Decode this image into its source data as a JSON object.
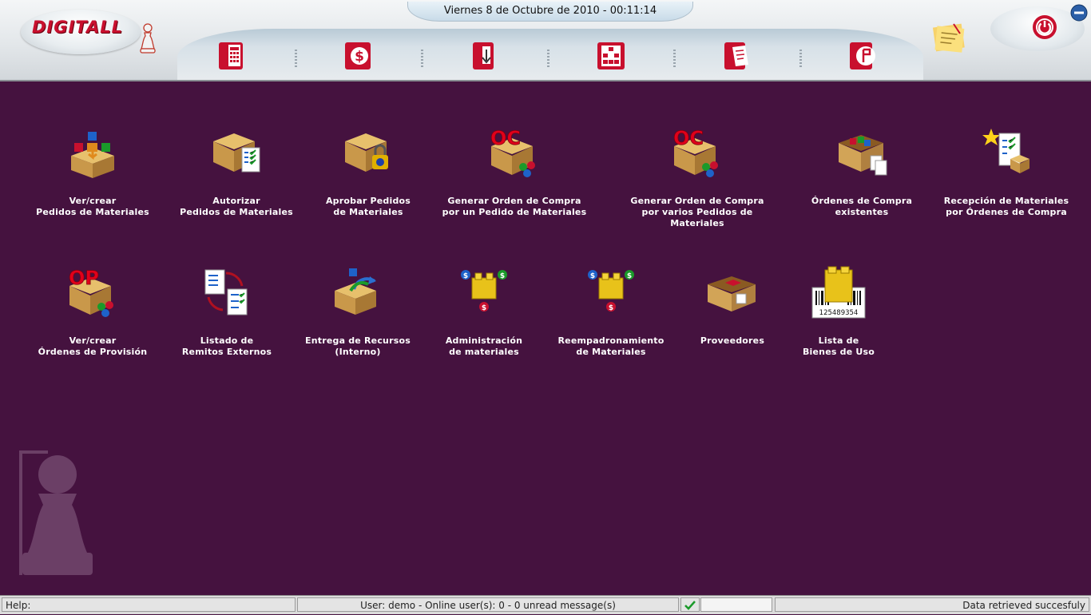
{
  "header": {
    "logo": "DIGITALL",
    "datetime": "Viernes 8 de Octubre de 2010 - 00:11:14",
    "nav_icons": [
      "calculator-icon",
      "dollar-icon",
      "inventory-icon",
      "org-chart-icon",
      "documents-icon",
      "report-icon"
    ],
    "accent_color": "#c8102e"
  },
  "tiles": [
    {
      "line1": "Ver/crear",
      "line2": "Pedidos de Materiales",
      "icon": "box-cubes-icon"
    },
    {
      "line1": "Autorizar",
      "line2": "Pedidos de Materiales",
      "icon": "box-checklist-icon"
    },
    {
      "line1": "Aprobar Pedidos",
      "line2": "de Materiales",
      "icon": "box-lock-icon"
    },
    {
      "line1": "Generar Orden de Compra",
      "line2": "por un Pedido de Materiales",
      "icon": "oc-box-icon",
      "badge": "OC"
    },
    {
      "line1": "Generar Orden de Compra",
      "line2": "por varios Pedidos de Materiales",
      "icon": "oc-box-icon",
      "badge": "OC"
    },
    {
      "line1": "Órdenes de Compra",
      "line2": "existentes",
      "icon": "open-box-docs-icon"
    },
    {
      "line1": "Recepción de Materiales",
      "line2": "por Órdenes de Compra",
      "icon": "checklist-box-star-icon"
    },
    {
      "line1": "Ver/crear",
      "line2": "Órdenes de Provisión",
      "icon": "op-box-icon",
      "badge": "OP"
    },
    {
      "line1": "Listado de",
      "line2": "Remitos Externos",
      "icon": "documents-cycle-icon"
    },
    {
      "line1": "Entrega de Recursos",
      "line2": "(Interno)",
      "icon": "box-arrow-icon"
    },
    {
      "line1": "Administración",
      "line2": "de materiales",
      "icon": "blocks-money-icon"
    },
    {
      "line1": "Reempadronamiento",
      "line2": "de Materiales",
      "icon": "blocks-money-icon"
    },
    {
      "line1": "Proveedores",
      "line2": "",
      "icon": "supplier-box-icon"
    },
    {
      "line1": "Lista de",
      "line2": "Bienes de Uso",
      "icon": "barcode-blocks-icon",
      "barcode": "125489354"
    }
  ],
  "status": {
    "help": "Help:",
    "user": "User: demo - Online user(s): 0 - 0 unread message(s)",
    "result": "Data retrieved succesfuly"
  }
}
